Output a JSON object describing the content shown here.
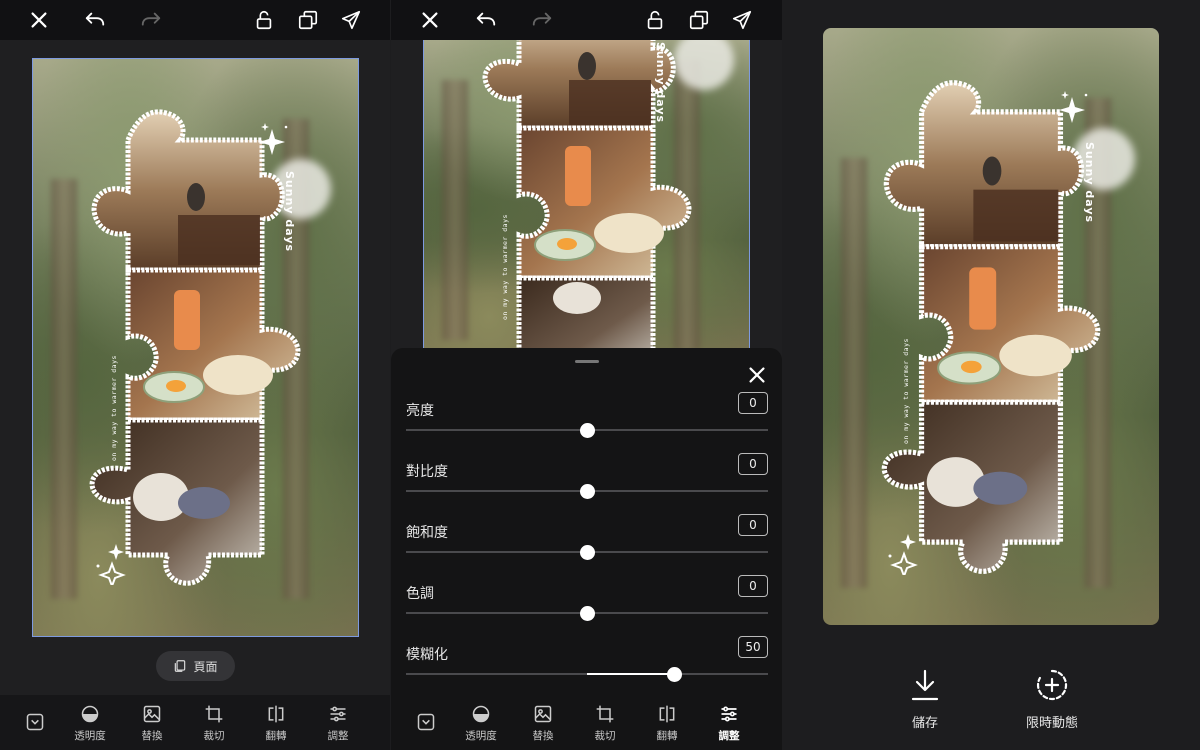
{
  "editor": {
    "page_button_label": "頁面",
    "stickers": {
      "sunny": "Sunny days",
      "on_my_way": "on my way to warmer days"
    }
  },
  "toolbar": {
    "tools": [
      {
        "icon": "collapse-icon",
        "label": ""
      },
      {
        "icon": "opacity-icon",
        "label": "透明度"
      },
      {
        "icon": "replace-image-icon",
        "label": "替換"
      },
      {
        "icon": "crop-icon",
        "label": "裁切"
      },
      {
        "icon": "flip-icon",
        "label": "翻轉"
      },
      {
        "icon": "adjust-icon",
        "label": "調整"
      }
    ]
  },
  "adjust": {
    "items": [
      {
        "label": "亮度",
        "value": "0",
        "level": 0.5
      },
      {
        "label": "對比度",
        "value": "0",
        "level": 0.5
      },
      {
        "label": "飽和度",
        "value": "0",
        "level": 0.5
      },
      {
        "label": "色調",
        "value": "0",
        "level": 0.5
      },
      {
        "label": "模糊化",
        "value": "50",
        "level": 0.74
      }
    ]
  },
  "export": {
    "save_label": "儲存",
    "story_label": "限時動態"
  },
  "colors": {
    "selection": "#7e9ae0",
    "accent": "#ffffff"
  }
}
